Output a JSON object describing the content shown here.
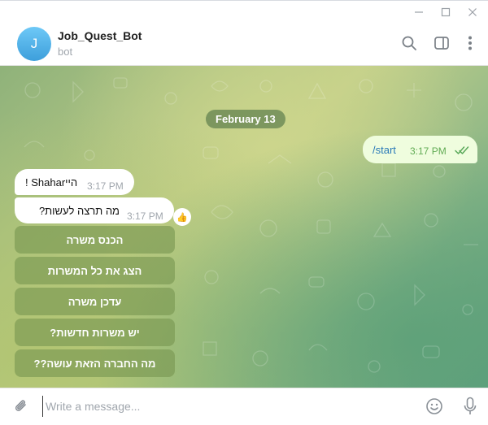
{
  "window": {
    "minimize_icon": "minimize-icon",
    "maximize_icon": "maximize-icon",
    "close_icon": "close-icon"
  },
  "header": {
    "avatar_letter": "J",
    "bot_name": "Job_Quest_Bot",
    "status": "bot",
    "avatar_color": "#4fb3ec",
    "icons": [
      "search-icon",
      "sidebar-toggle-icon",
      "more-vertical-icon"
    ]
  },
  "chat": {
    "date_label": "February 13",
    "outgoing": {
      "text": "/start",
      "time": "3:17 PM",
      "status_icon": "double-check-icon",
      "bubble_color": "#effdde"
    },
    "incoming": [
      {
        "text": "! Shaharהיי",
        "time": "3:17 PM"
      },
      {
        "text": "מה תרצה לעשות?",
        "time": "3:17 PM",
        "reaction": "👍"
      }
    ],
    "keyboard_buttons": [
      "הכנס משרה",
      "הצג את כל המשרות",
      "עדכן משרה",
      "יש משרות חדשות?",
      "מה החברה הזאת עושה??"
    ]
  },
  "composer": {
    "placeholder": "Write a message...",
    "value": "",
    "icons": [
      "paperclip-icon",
      "emoji-icon",
      "microphone-icon"
    ]
  }
}
